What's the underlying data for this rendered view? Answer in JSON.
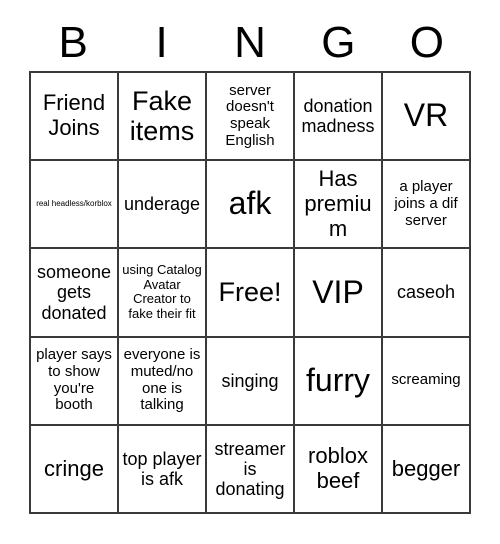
{
  "card": {
    "title": "BINGO",
    "header_letters": [
      "B",
      "I",
      "N",
      "G",
      "O"
    ],
    "border_color": "#3a3a3a",
    "background_color": "#ffffff",
    "text_color": "#000000",
    "grid_size": "5x5",
    "rows": [
      [
        {
          "text": "Friend Joins",
          "size": "lg"
        },
        {
          "text": "Fake items",
          "size": "xl"
        },
        {
          "text": "server doesn't speak English",
          "size": "sm"
        },
        {
          "text": "donation madness",
          "size": "md"
        },
        {
          "text": "VR",
          "size": "xxl"
        }
      ],
      [
        {
          "text": "real headless/korblox",
          "size": "xxs"
        },
        {
          "text": "underage",
          "size": "md"
        },
        {
          "text": "afk",
          "size": "xxl"
        },
        {
          "text": "Has premium",
          "size": "lg"
        },
        {
          "text": "a player joins a dif server",
          "size": "sm"
        }
      ],
      [
        {
          "text": "someone gets donated",
          "size": "md"
        },
        {
          "text": "using Catalog Avatar Creator to fake their fit",
          "size": "xs"
        },
        {
          "text": "Free!",
          "size": "xl"
        },
        {
          "text": "VIP",
          "size": "xxl"
        },
        {
          "text": "caseoh",
          "size": "md"
        }
      ],
      [
        {
          "text": "player says to show you're booth",
          "size": "sm"
        },
        {
          "text": "everyone is muted/no one is talking",
          "size": "sm"
        },
        {
          "text": "singing",
          "size": "md"
        },
        {
          "text": "furry",
          "size": "xxl"
        },
        {
          "text": "screaming",
          "size": "sm"
        }
      ],
      [
        {
          "text": "cringe",
          "size": "lg"
        },
        {
          "text": "top player is afk",
          "size": "md"
        },
        {
          "text": "streamer is donating",
          "size": "md"
        },
        {
          "text": "roblox beef",
          "size": "lg"
        },
        {
          "text": "begger",
          "size": "lg"
        }
      ]
    ]
  }
}
